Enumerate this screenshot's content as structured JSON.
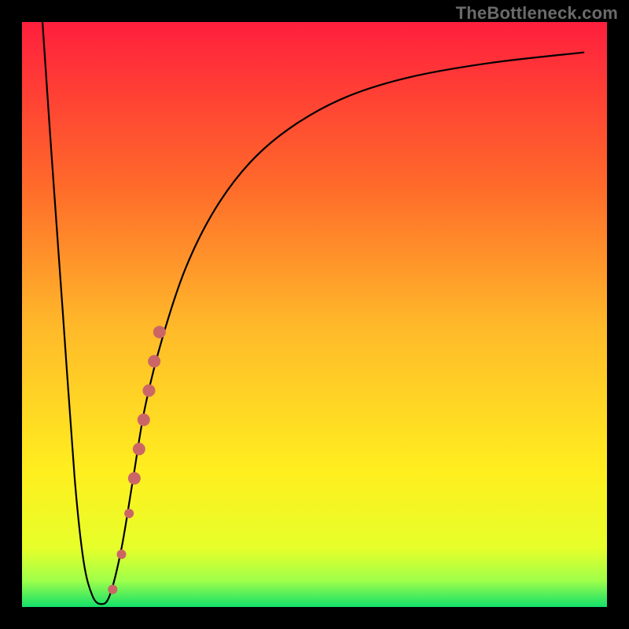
{
  "watermark": "TheBottleneck.com",
  "chart_data": {
    "type": "line",
    "title": "",
    "xlabel": "",
    "ylabel": "",
    "xlim": [
      0,
      100
    ],
    "ylim": [
      0,
      100
    ],
    "grid": false,
    "legend": false,
    "background_gradient_stops": [
      {
        "offset": 0.0,
        "color": "#ff1f3d"
      },
      {
        "offset": 0.28,
        "color": "#ff6a2a"
      },
      {
        "offset": 0.52,
        "color": "#ffb92a"
      },
      {
        "offset": 0.77,
        "color": "#ffef1f"
      },
      {
        "offset": 0.9,
        "color": "#e6ff2a"
      },
      {
        "offset": 0.955,
        "color": "#9fff4a"
      },
      {
        "offset": 1.0,
        "color": "#13e06a"
      }
    ],
    "series": [
      {
        "name": "bottleneck-curve",
        "x": [
          3.5,
          5,
          7,
          9,
          10.5,
          12,
          13.5,
          15,
          17,
          19,
          21,
          24,
          28,
          33,
          39,
          46,
          55,
          66,
          80,
          96
        ],
        "y": [
          100,
          78,
          50,
          22,
          8,
          2,
          0.5,
          2,
          10,
          22,
          34,
          46,
          58,
          68,
          76,
          82,
          87,
          90.5,
          93,
          94.8
        ]
      }
    ],
    "markers": {
      "name": "highlight-dots",
      "color": "#cc6666",
      "points": [
        {
          "x": 15.5,
          "y": 3,
          "r": 6
        },
        {
          "x": 17.0,
          "y": 9,
          "r": 6
        },
        {
          "x": 18.3,
          "y": 16,
          "r": 6
        },
        {
          "x": 19.2,
          "y": 22,
          "r": 8
        },
        {
          "x": 20.0,
          "y": 27,
          "r": 8
        },
        {
          "x": 20.8,
          "y": 32,
          "r": 8
        },
        {
          "x": 21.7,
          "y": 37,
          "r": 8
        },
        {
          "x": 22.6,
          "y": 42,
          "r": 8
        },
        {
          "x": 23.5,
          "y": 47,
          "r": 8
        }
      ]
    }
  }
}
